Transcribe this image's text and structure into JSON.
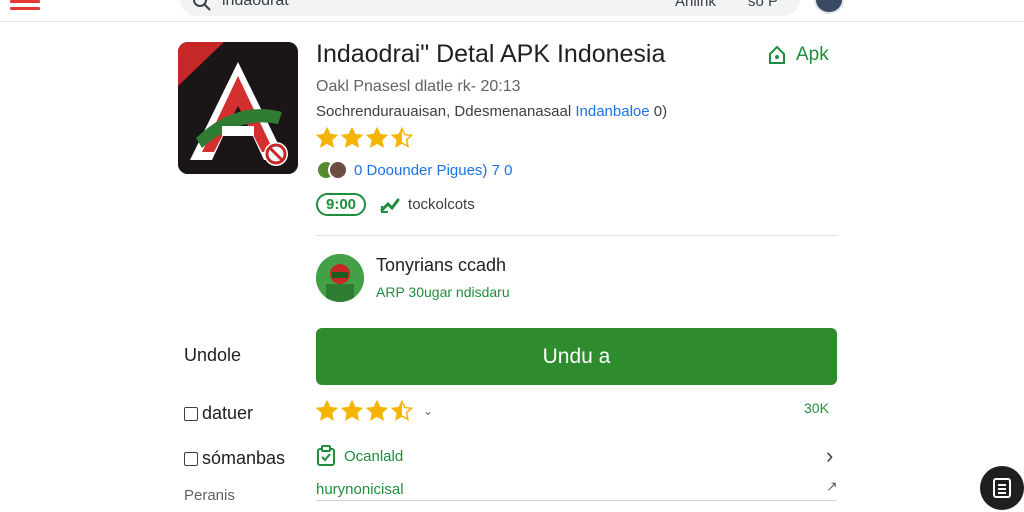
{
  "search": {
    "query": "indaodrat",
    "filter": "Ahlink",
    "extra": "so P"
  },
  "app": {
    "title": "Indaodrai\" Detal APK Indonesia",
    "apk_link": "Apk",
    "subtitle": "Oakl Pnasesl dlatle rk- 20:13",
    "desc_prefix": "Sochrendurauaisan, Ddesmenanasaal ",
    "desc_highlight": "Indanbaloe",
    "desc_suffix": " 0)",
    "rating": 3.5,
    "developer_line": "0 Doounder Pigues) 7 0",
    "count_badge": "9:00",
    "tag": "tockolcots"
  },
  "developer_card": {
    "name": "Tonyrians ccadh",
    "subtitle": "ARP 30ugar ndisdaru"
  },
  "left_labels": {
    "download": "Undole",
    "datuer": "datuer",
    "somanbas": "sómanbas",
    "peranis": "Peranis"
  },
  "download": {
    "label": "Undu a"
  },
  "rating_row": {
    "rating": 3.5,
    "right_value": "30K"
  },
  "standard": {
    "label": "Ocanlald"
  },
  "link": {
    "label": "hurynonicisal"
  },
  "colors": {
    "accent_green": "#2e8b2e",
    "link_blue": "#1a73e8",
    "star": "#f4b400",
    "menu_red": "#e53935"
  }
}
